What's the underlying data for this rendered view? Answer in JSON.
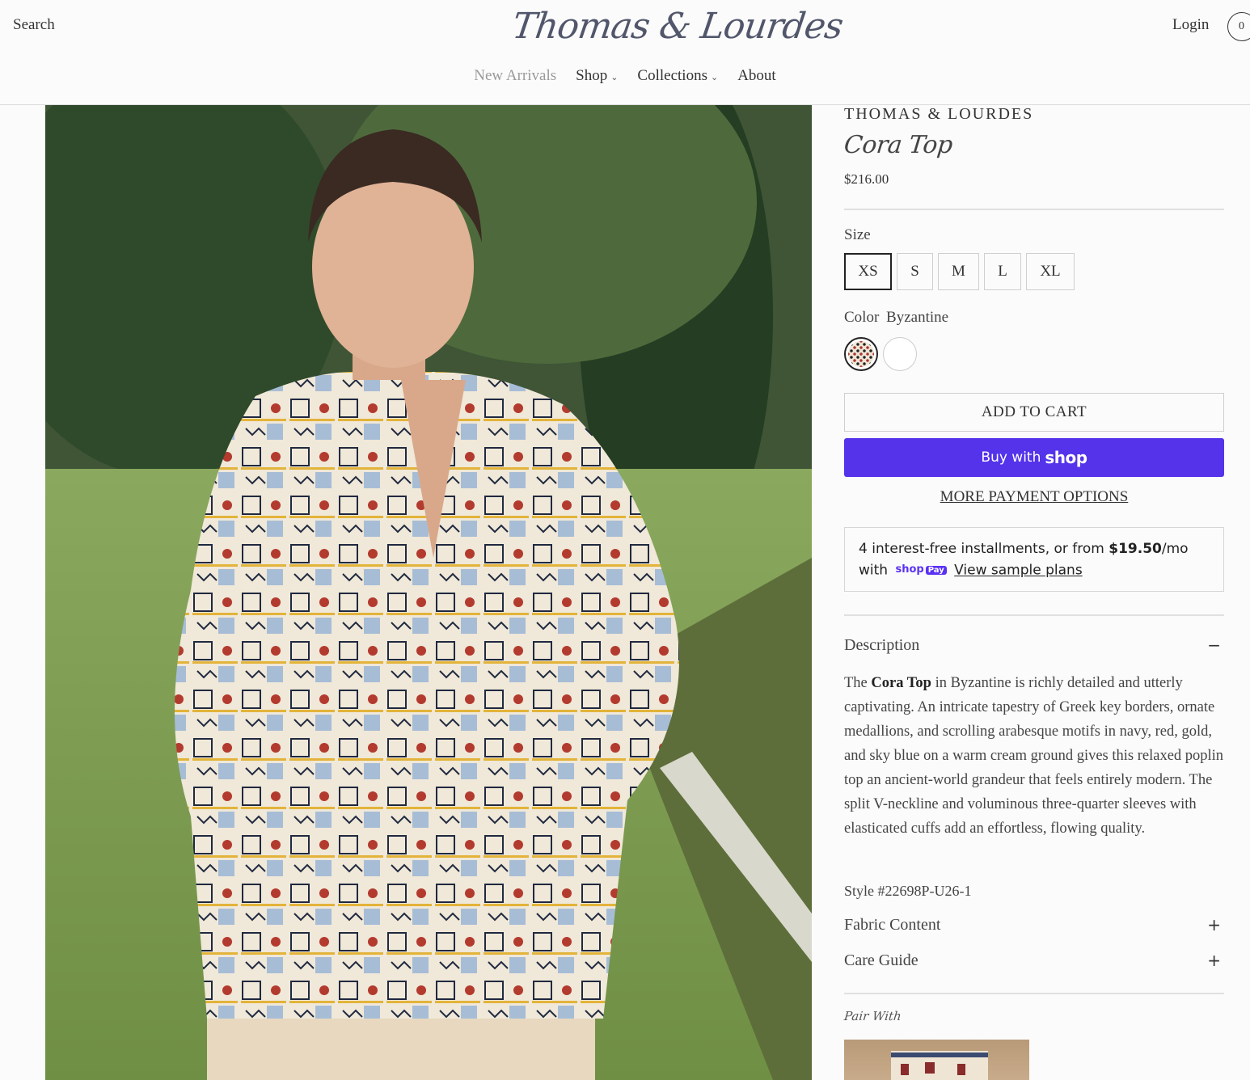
{
  "header": {
    "search_label": "Search",
    "logo_text": "Thomas & Lourdes",
    "login_label": "Login",
    "cart_count": "0"
  },
  "nav": {
    "items": [
      {
        "label": "New Arrivals",
        "has_dropdown": false
      },
      {
        "label": "Shop",
        "has_dropdown": true
      },
      {
        "label": "Collections",
        "has_dropdown": true
      },
      {
        "label": "About",
        "has_dropdown": false
      }
    ]
  },
  "product": {
    "brand": "THOMAS & LOURDES",
    "title": "Cora Top",
    "price": "$216.00",
    "size_label": "Size",
    "sizes": [
      "XS",
      "S",
      "M",
      "L",
      "XL"
    ],
    "selected_size": "XS",
    "color_label": "Color",
    "color_value": "Byzantine",
    "add_to_cart": "ADD TO CART",
    "buy_with": "Buy with",
    "buy_with_brand": "shop",
    "more_payment": "MORE PAYMENT OPTIONS",
    "installments": {
      "line1_pre": "4 interest-free installments, or from ",
      "amount": "$19.50",
      "line1_post": "/mo",
      "with": "with",
      "badge_shop": "shop",
      "badge_pay": "Pay",
      "view_plans": "View sample plans"
    }
  },
  "accordion": {
    "description_title": "Description",
    "description_sign": "−",
    "desc_pre": "The ",
    "desc_bold": "Cora Top",
    "desc_post": " in Byzantine is richly detailed and utterly captivating. An intricate tapestry of Greek key borders, ornate medallions, and scrolling arabesque motifs in navy, red, gold, and sky blue on a warm cream ground gives this relaxed poplin top an ancient-world grandeur that feels entirely modern. The split V-neckline and voluminous three-quarter sleeves with elasticated cuffs add an effortless, flowing quality.",
    "style_number": "Style #22698P-U26-1",
    "fabric_title": "Fabric Content",
    "care_title": "Care Guide",
    "plus_sign": "+"
  },
  "pair_with": {
    "label": "Pair With"
  },
  "colors": {
    "shop_purple": "#5433eb",
    "logo": "#51566b"
  }
}
